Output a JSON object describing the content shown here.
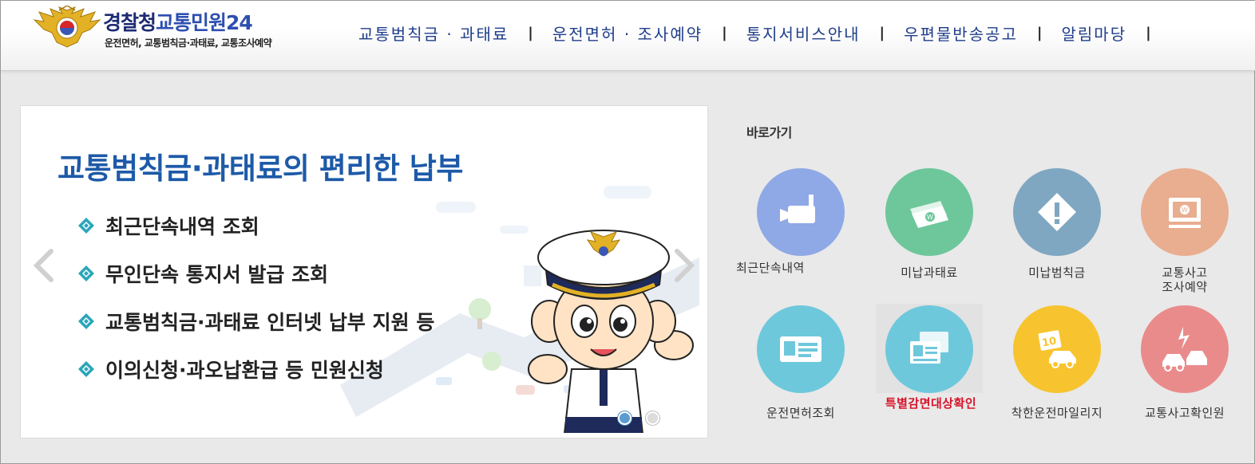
{
  "header": {
    "logo_title_1": "경찰청",
    "logo_title_2": "교통민원24",
    "logo_sub": "운전면허, 교통범칙금·과태료, 교통조사예약",
    "nav": [
      {
        "label": "교통범칙금 · 과태료"
      },
      {
        "label": "운전면허 · 조사예약"
      },
      {
        "label": "통지서비스안내"
      },
      {
        "label": "우편물반송공고"
      },
      {
        "label": "알림마당"
      }
    ],
    "separator": "|"
  },
  "slider": {
    "title": "교통범칙금·과태료의 편리한 납부",
    "items": [
      {
        "label": "최근단속내역 조회"
      },
      {
        "label": "무인단속 통지서 발급 조회"
      },
      {
        "label": "교통범칙금·과태료 인터넷 납부 지원 등"
      },
      {
        "label": "이의신청·과오납환급 등 민원신청"
      }
    ],
    "active_slide": 1,
    "total_slides": 2
  },
  "quick": {
    "title": "바로가기",
    "items": [
      {
        "label": "최근단속내역",
        "icon": "cctv-camera-icon",
        "color": "#8fa8e6"
      },
      {
        "label": "미납과태료",
        "icon": "money-bills-icon",
        "color": "#6dc79b"
      },
      {
        "label": "미납범칙금",
        "icon": "warning-diamond-icon",
        "color": "#7fa7c1"
      },
      {
        "label": "교통사고\n조사예약",
        "icon": "monitor-won-icon",
        "color": "#e9ad8f"
      },
      {
        "label": "운전면허조회",
        "icon": "license-card-icon",
        "color": "#6ec8dc"
      },
      {
        "label": "특별감면대상확인",
        "icon": "id-cards-icon",
        "color": "#6ec8dc"
      },
      {
        "label": "착한운전마일리지",
        "icon": "mileage-car-icon",
        "color": "#f7c42f"
      },
      {
        "label": "교통사고확인원",
        "icon": "car-crash-icon",
        "color": "#ea8b8b"
      }
    ]
  }
}
